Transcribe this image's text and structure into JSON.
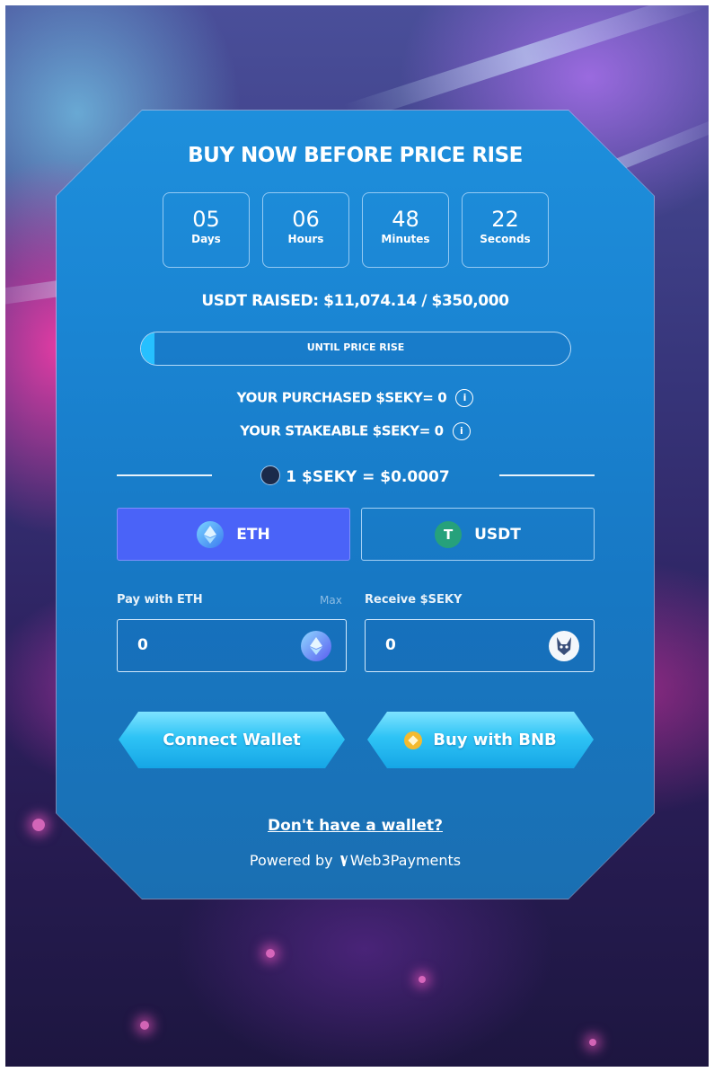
{
  "widget": {
    "title": "BUY NOW BEFORE PRICE RISE",
    "countdown": [
      {
        "value": "05",
        "label": "Days"
      },
      {
        "value": "06",
        "label": "Hours"
      },
      {
        "value": "48",
        "label": "Minutes"
      },
      {
        "value": "22",
        "label": "Seconds"
      }
    ],
    "raised_text": "USDT RAISED: $11,074.14 / $350,000",
    "progress": {
      "label": "UNTIL PRICE RISE",
      "fraction": 0.032
    },
    "purchased_text": "YOUR PURCHASED $SEKY= 0",
    "stakeable_text": "YOUR STAKEABLE $SEKY= 0",
    "info_icon": "i",
    "rate_text": "1 $SEKY = $0.0007",
    "currency_buttons": [
      {
        "label": "ETH",
        "icon": "eth-icon",
        "active": true
      },
      {
        "label": "USDT",
        "icon": "usdt-icon",
        "active": false
      }
    ],
    "usdt_symbol": "T",
    "pay_label": "Pay with ETH",
    "max_label": "Max",
    "receive_label": "Receive $SEKY",
    "pay_value": "0",
    "receive_value": "0",
    "connect_wallet_label": "Connect Wallet",
    "buy_bnb_label": "Buy with BNB",
    "no_wallet_link": "Don't have a wallet?",
    "powered_by_prefix": "Powered by",
    "powered_by_brand": "Web3Payments"
  },
  "colors": {
    "card": "#1a84d2",
    "active_button": "#4a63f8",
    "action_button": "#2ec3f5",
    "usdt_green": "#26a17b",
    "bnb_yellow": "#f3ba2f"
  }
}
